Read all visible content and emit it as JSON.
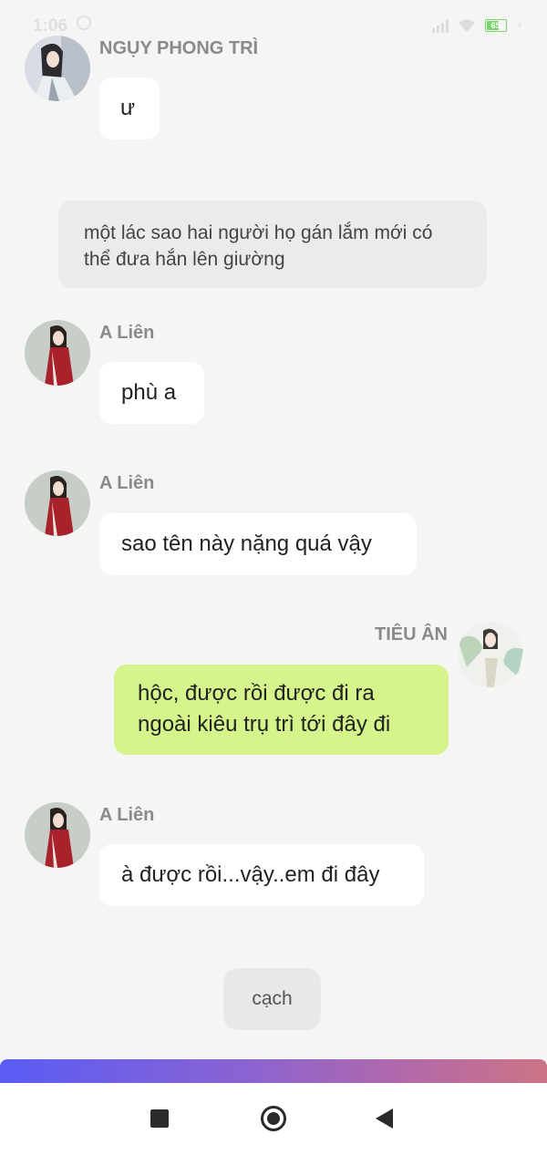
{
  "status_bar": {
    "time": "1:06",
    "battery": "65"
  },
  "messages": [
    {
      "sender": "NGỤY PHONG TRÌ",
      "text": "ư"
    },
    {
      "narration": "một lác sao hai người họ gán lắm mới có thể đưa hắn lên giường"
    },
    {
      "sender": "A Liên",
      "text": "phù a"
    },
    {
      "sender": "A Liên",
      "text": "sao tên này nặng quá vậy"
    },
    {
      "sender": "TIÊU ÂN",
      "text_line1": "hộc, được rồi được đi ra",
      "text_line2": "ngoài kiêu trụ trì tới đây đi"
    },
    {
      "sender": "A Liên",
      "text": "à được rồi...vậy..em đi đây"
    }
  ],
  "action_button": "cạch",
  "progress": 1.0,
  "colors": {
    "background": "#f5f5f5",
    "incoming_bubble": "#ffffff",
    "outgoing_bubble": "#d5f58c",
    "narration_bubble": "#ebebeb",
    "progress_gradient_start": "#5a5cf5",
    "progress_gradient_end": "#cc7485"
  },
  "icons": {
    "nav_recents": "square-icon",
    "nav_home": "circle-icon",
    "nav_back": "triangle-back-icon"
  }
}
